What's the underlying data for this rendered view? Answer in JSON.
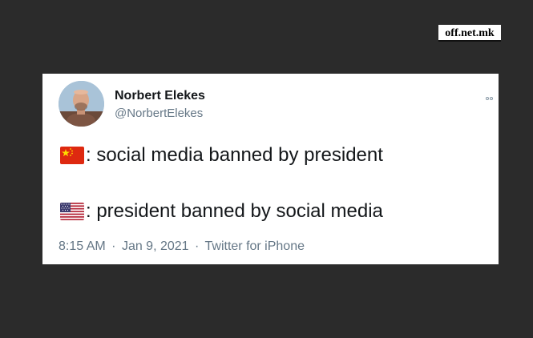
{
  "watermark": {
    "text": "off.net.mk"
  },
  "tweet": {
    "author": {
      "display_name": "Norbert Elekes",
      "handle": "@NorbertElekes",
      "avatar_icon": "profile-photo"
    },
    "lines": [
      {
        "flag_icon": "china-flag-icon",
        "text": ": social media banned by president"
      },
      {
        "flag_icon": "usa-flag-icon",
        "text": ": president banned by social media"
      }
    ],
    "meta": {
      "time": "8:15 AM",
      "separator": "·",
      "date": "Jan 9, 2021",
      "source": "Twitter for iPhone"
    },
    "more_icon": "more-options-icon"
  },
  "colors": {
    "background": "#2b2b2b",
    "card": "#ffffff",
    "text_primary": "#14171a",
    "text_secondary": "#657786",
    "china_red": "#de2910",
    "china_yellow": "#ffde00",
    "usa_red": "#b22234",
    "usa_blue": "#3c3b6e"
  }
}
